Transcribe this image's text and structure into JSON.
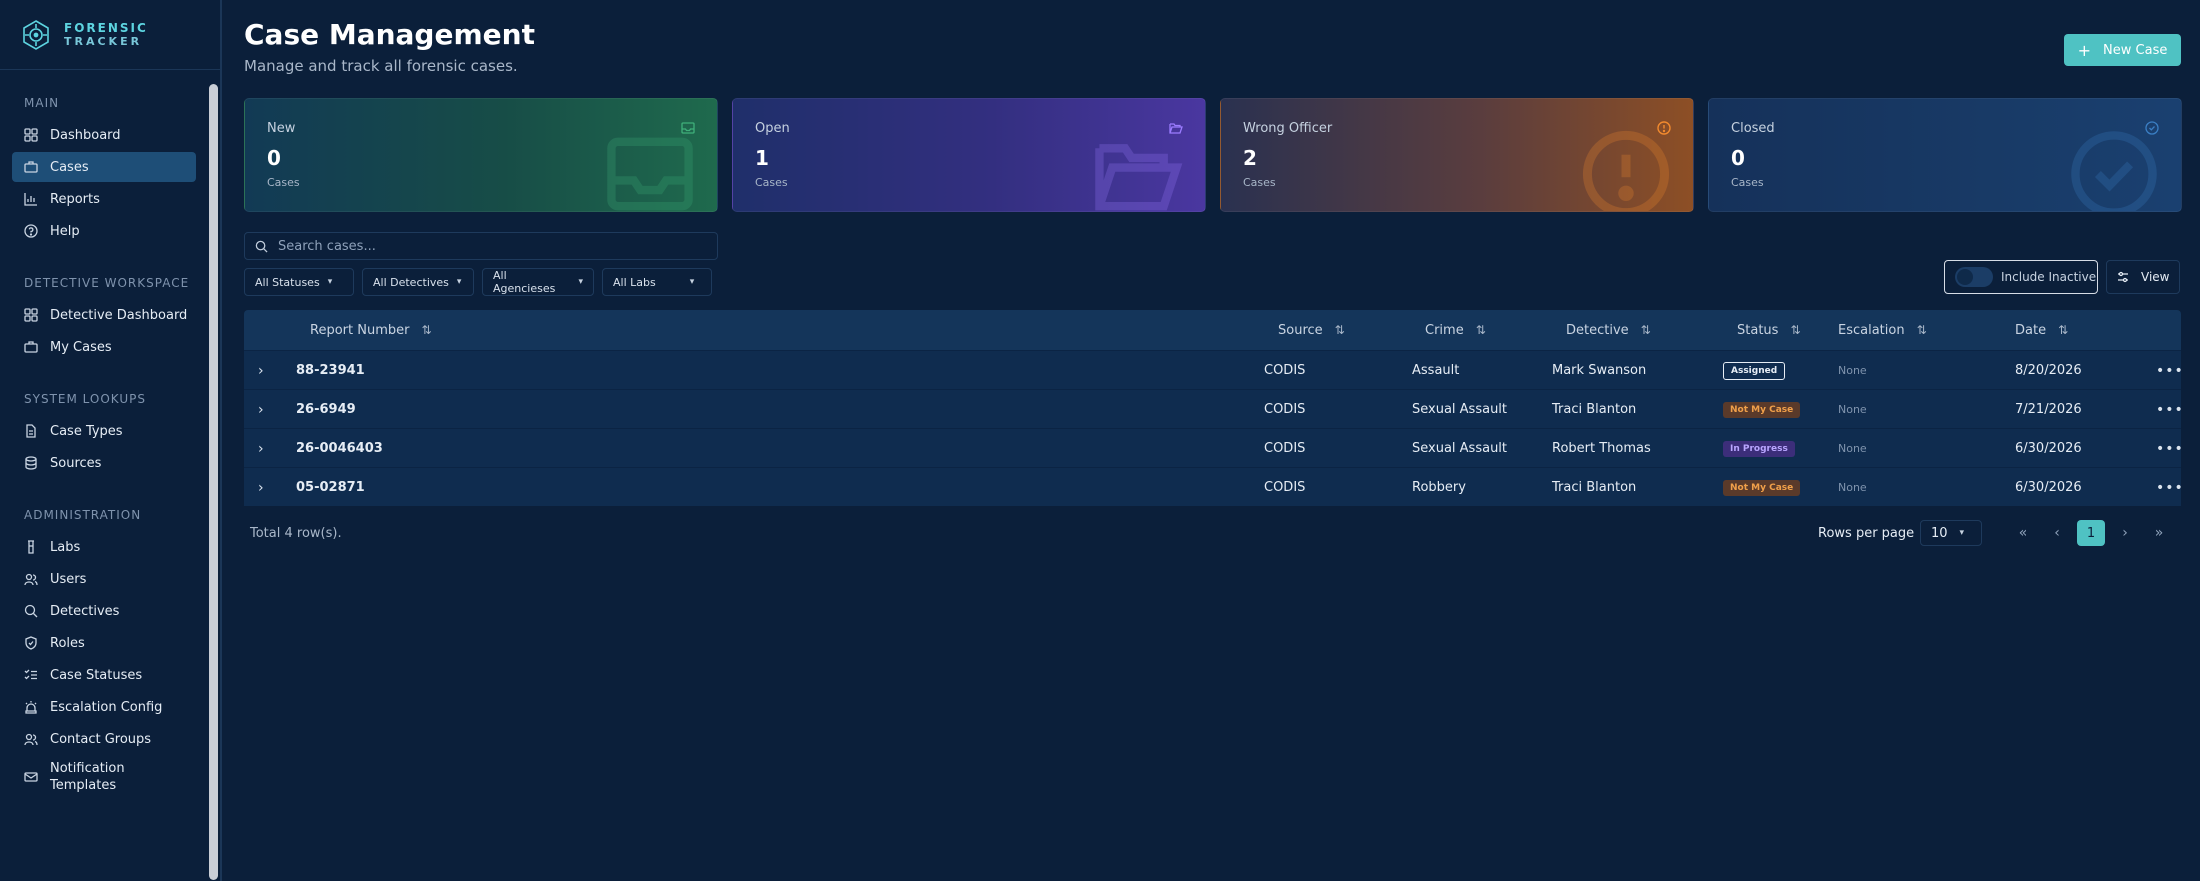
{
  "brand": {
    "line1": "FORENSIC",
    "line2": "TRACKER"
  },
  "sidebar": {
    "sections": [
      {
        "title": "MAIN",
        "items": [
          {
            "label": "Dashboard",
            "icon": "grid-icon"
          },
          {
            "label": "Cases",
            "icon": "briefcase-icon",
            "active": true
          },
          {
            "label": "Reports",
            "icon": "bar-chart-icon"
          },
          {
            "label": "Help",
            "icon": "help-circle-icon"
          }
        ]
      },
      {
        "title": "DETECTIVE WORKSPACE",
        "items": [
          {
            "label": "Detective Dashboard",
            "icon": "grid-icon"
          },
          {
            "label": "My Cases",
            "icon": "briefcase-icon"
          }
        ]
      },
      {
        "title": "SYSTEM LOOKUPS",
        "items": [
          {
            "label": "Case Types",
            "icon": "file-icon"
          },
          {
            "label": "Sources",
            "icon": "database-icon"
          }
        ]
      },
      {
        "title": "ADMINISTRATION",
        "items": [
          {
            "label": "Labs",
            "icon": "flask-icon"
          },
          {
            "label": "Users",
            "icon": "users-icon"
          },
          {
            "label": "Detectives",
            "icon": "search-icon"
          },
          {
            "label": "Roles",
            "icon": "shield-icon"
          },
          {
            "label": "Case Statuses",
            "icon": "list-checks-icon"
          },
          {
            "label": "Escalation Config",
            "icon": "siren-icon"
          },
          {
            "label": "Contact Groups",
            "icon": "users-icon"
          },
          {
            "label": "Notification Templates",
            "icon": "mail-icon"
          }
        ]
      }
    ]
  },
  "header": {
    "title": "Case Management",
    "subtitle": "Manage and track all forensic cases.",
    "new_case_label": "New Case"
  },
  "cards": [
    {
      "title": "New",
      "value": "0",
      "sub": "Cases",
      "icon": "inbox-icon",
      "accent": "#3fb07a"
    },
    {
      "title": "Open",
      "value": "1",
      "sub": "Cases",
      "icon": "folder-open-icon",
      "accent": "#8a6cff"
    },
    {
      "title": "Wrong Officer",
      "value": "2",
      "sub": "Cases",
      "icon": "alert-circle-icon",
      "accent": "#f28a2e"
    },
    {
      "title": "Closed",
      "value": "0",
      "sub": "Cases",
      "icon": "check-circle-icon",
      "accent": "#3b7fc4"
    }
  ],
  "search": {
    "placeholder": "Search cases..."
  },
  "filters": [
    "All Statuses",
    "All Detectives",
    "All Agencieses",
    "All Labs"
  ],
  "toggle": {
    "label": "Include Inactive",
    "on": false
  },
  "view_label": "View",
  "table": {
    "columns": [
      "Report Number",
      "Source",
      "Crime",
      "Detective",
      "Status",
      "Escalation",
      "Date"
    ],
    "rows": [
      {
        "report": "88-23941",
        "source": "CODIS",
        "crime": "Assault",
        "detective": "Mark Swanson",
        "status": "Assigned",
        "escalation": "None",
        "date": "8/20/2026"
      },
      {
        "report": "26-6949",
        "source": "CODIS",
        "crime": "Sexual Assault",
        "detective": "Traci Blanton",
        "status": "Not My Case",
        "escalation": "None",
        "date": "7/21/2026"
      },
      {
        "report": "26-0046403",
        "source": "CODIS",
        "crime": "Sexual Assault",
        "detective": "Robert Thomas",
        "status": "In Progress",
        "escalation": "None",
        "date": "6/30/2026"
      },
      {
        "report": "05-02871",
        "source": "CODIS",
        "crime": "Robbery",
        "detective": "Traci Blanton",
        "status": "Not My Case",
        "escalation": "None",
        "date": "6/30/2026"
      }
    ]
  },
  "footer": {
    "total": "Total 4 row(s).",
    "rows_per_page_label": "Rows per page",
    "rows_per_page_value": "10",
    "current_page": "1"
  },
  "colors": {
    "accent": "#4fc2c3",
    "background": "#0b1f3a"
  }
}
